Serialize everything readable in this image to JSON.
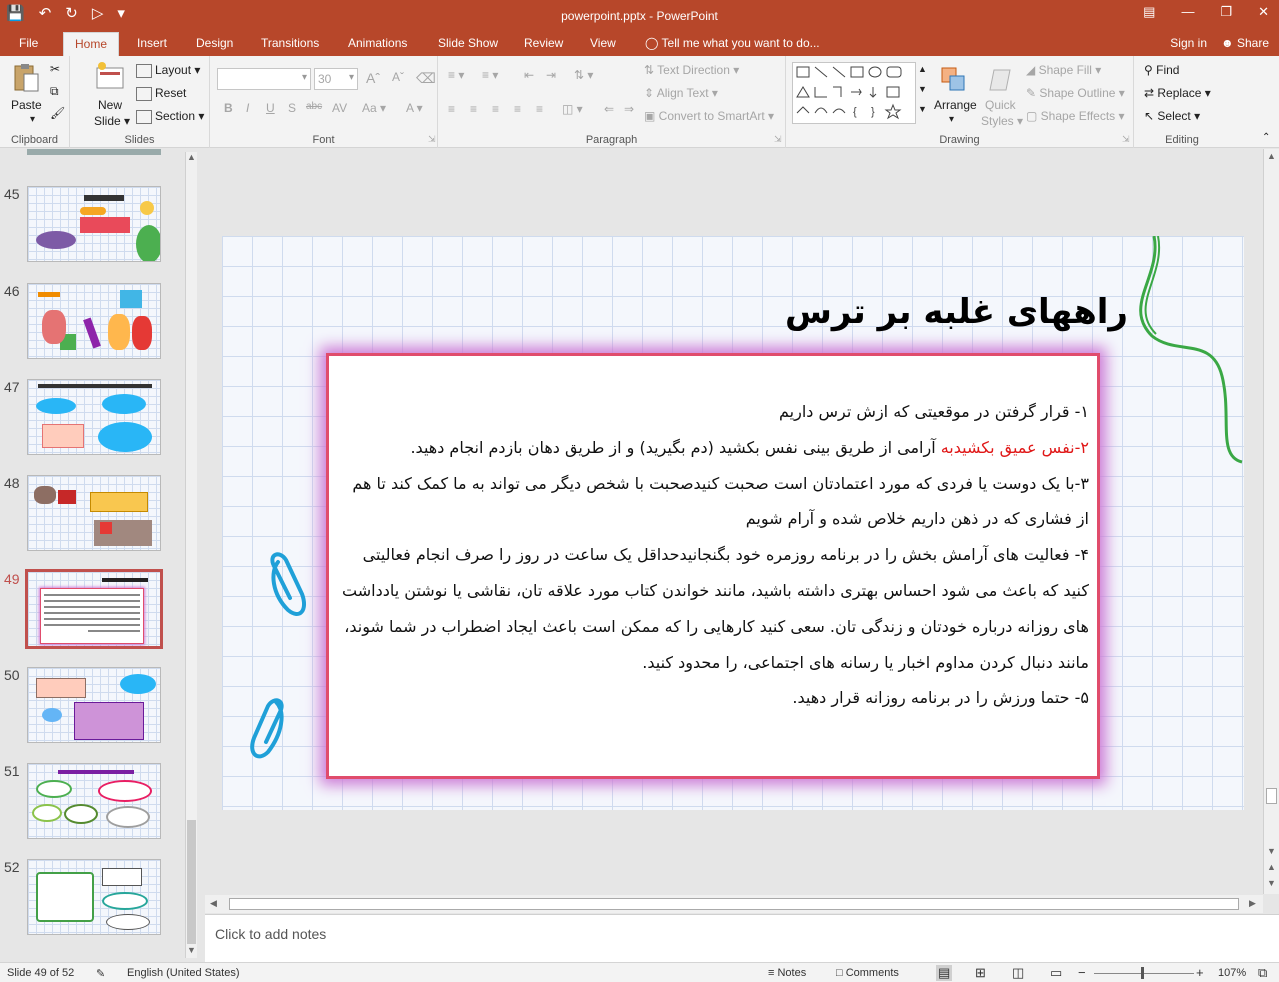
{
  "titlebar": {
    "title": "powerpoint.pptx - PowerPoint"
  },
  "tabs": [
    "File",
    "Home",
    "Insert",
    "Design",
    "Transitions",
    "Animations",
    "Slide Show",
    "Review",
    "View"
  ],
  "active_tab": "Home",
  "tell_me": "Tell me what you want to do...",
  "signin": "Sign in",
  "share": "Share",
  "ribbon": {
    "clipboard": {
      "label": "Clipboard",
      "paste": "Paste"
    },
    "slides": {
      "label": "Slides",
      "new_slide_1": "New",
      "new_slide_2": "Slide",
      "layout": "Layout",
      "reset": "Reset",
      "section": "Section"
    },
    "font": {
      "label": "Font",
      "font_size": "30"
    },
    "paragraph": {
      "label": "Paragraph",
      "text_direction": "Text Direction",
      "align_text": "Align Text",
      "smartart": "Convert to SmartArt"
    },
    "drawing": {
      "label": "Drawing",
      "arrange": "Arrange",
      "quick_styles_1": "Quick",
      "quick_styles_2": "Styles",
      "shape_fill": "Shape Fill",
      "shape_outline": "Shape Outline",
      "shape_effects": "Shape Effects"
    },
    "editing": {
      "label": "Editing",
      "find": "Find",
      "replace": "Replace",
      "select": "Select"
    }
  },
  "thumbnails": [
    {
      "num": "45",
      "selected": false
    },
    {
      "num": "46",
      "selected": false
    },
    {
      "num": "47",
      "selected": false
    },
    {
      "num": "48",
      "selected": false
    },
    {
      "num": "49",
      "selected": true
    },
    {
      "num": "50",
      "selected": false
    },
    {
      "num": "51",
      "selected": false
    },
    {
      "num": "52",
      "selected": false
    }
  ],
  "slide": {
    "title": "راههای غلبه بر ترس",
    "line1": "۱- قرار گرفتن در موقعیتی که ازش ترس داریم",
    "line2_red": "۲-نفس عمیق بکشیدبه",
    "line2_rest": " آرامی از طریق بینی نفس بکشید (دم بگیرید) و از طریق دهان بازدم انجام دهید.",
    "line3": "۳-با یک دوست یا فردی که مورد اعتمادتان است صحبت کنیدصحبت با شخص دیگر می تواند به ما کمک کند تا هم از فشاری که در ذهن داریم خلاص شده و آرام شویم",
    "line4": "۴- فعالیت های آرامش بخش را در برنامه روزمره خود بگنجانیدحداقل یک ساعت در روز را صرف انجام فعالیتی کنید که باعث می شود احساس بهتری داشته باشید، مانند خواندن کتاب مورد علاقه تان، نقاشی یا نوشتن یادداشت های روزانه درباره خودتان و زندگی تان. سعی کنید کارهایی را که ممکن است باعث ایجاد اضطراب در شما شوند، مانند دنبال کردن مداوم اخبار یا رسانه های اجتماعی، را محدود کنید.",
    "line5": "۵- حتما ورزش را در برنامه روزانه قرار دهید."
  },
  "notes_placeholder": "Click to add notes",
  "status": {
    "slide": "Slide 49 of 52",
    "language": "English (United States)",
    "notes": "Notes",
    "comments": "Comments",
    "zoom": "107%"
  },
  "colors": {
    "brand": "#b7472a",
    "selected_thumb": "#c0504d",
    "slide_border": "#e04c6c",
    "red_text": "#e01818"
  }
}
